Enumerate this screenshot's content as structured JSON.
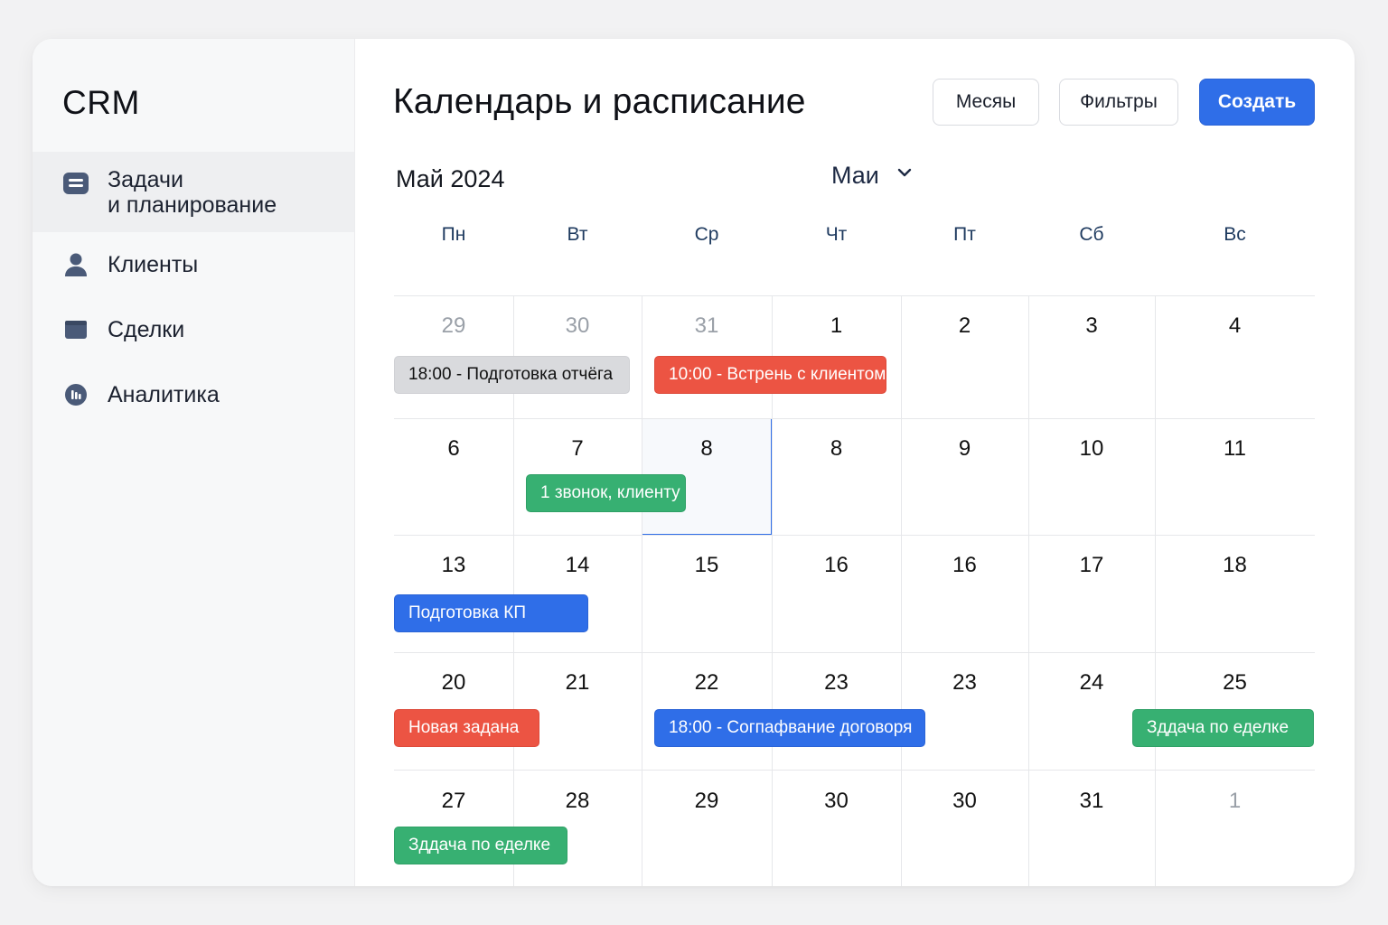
{
  "app": {
    "brand": "CRM"
  },
  "sidebar": {
    "items": [
      {
        "label_line1": "Задачи",
        "label_line2": "и планирование",
        "icon": "tasks-icon",
        "active": true
      },
      {
        "label": "Клиенты",
        "icon": "user-icon"
      },
      {
        "label": "Сделки",
        "icon": "folder-icon"
      },
      {
        "label": "Аналитика",
        "icon": "analytics-icon"
      }
    ]
  },
  "header": {
    "title": "Календарь и расписание",
    "months_label": "Месяы",
    "filters_label": "Фильтры",
    "create_label": "Создать"
  },
  "calendar": {
    "month_label": "Май 2024",
    "month_select": "Маи",
    "weekdays": [
      "Пн",
      "Вт",
      "Ср",
      "Чт",
      "Пт",
      "Сб",
      "Вс"
    ],
    "weeks": [
      [
        "29",
        "30",
        "31",
        "1",
        "2",
        "3",
        "4"
      ],
      [
        "6",
        "7",
        "8",
        "8",
        "9",
        "10",
        "11"
      ],
      [
        "13",
        "14",
        "15",
        "16",
        "16",
        "17",
        "18"
      ],
      [
        "20",
        "21",
        "22",
        "23",
        "23",
        "24",
        "25"
      ],
      [
        "27",
        "28",
        "29",
        "30",
        "30",
        "31",
        "1"
      ]
    ],
    "events": [
      {
        "text": "18:00 - Подготовка отчёга",
        "color": "gray"
      },
      {
        "text": "10:00 - Встрень с клиентом",
        "color": "red"
      },
      {
        "text": "1 звонок, клиенту",
        "color": "green"
      },
      {
        "text": "Подготовка КП",
        "color": "blue"
      },
      {
        "text": "Новая задана",
        "color": "red"
      },
      {
        "text": "18:00 - Согпафвание договоря",
        "color": "blue"
      },
      {
        "text": "Зддача по еделке",
        "color": "green"
      },
      {
        "text": "Зддача по еделке",
        "color": "green"
      }
    ]
  },
  "colors": {
    "accent": "#2f6ee8",
    "event_red": "#ec5443",
    "event_green": "#37b072",
    "event_gray": "#d9dadd",
    "icon": "#4a5a78"
  }
}
